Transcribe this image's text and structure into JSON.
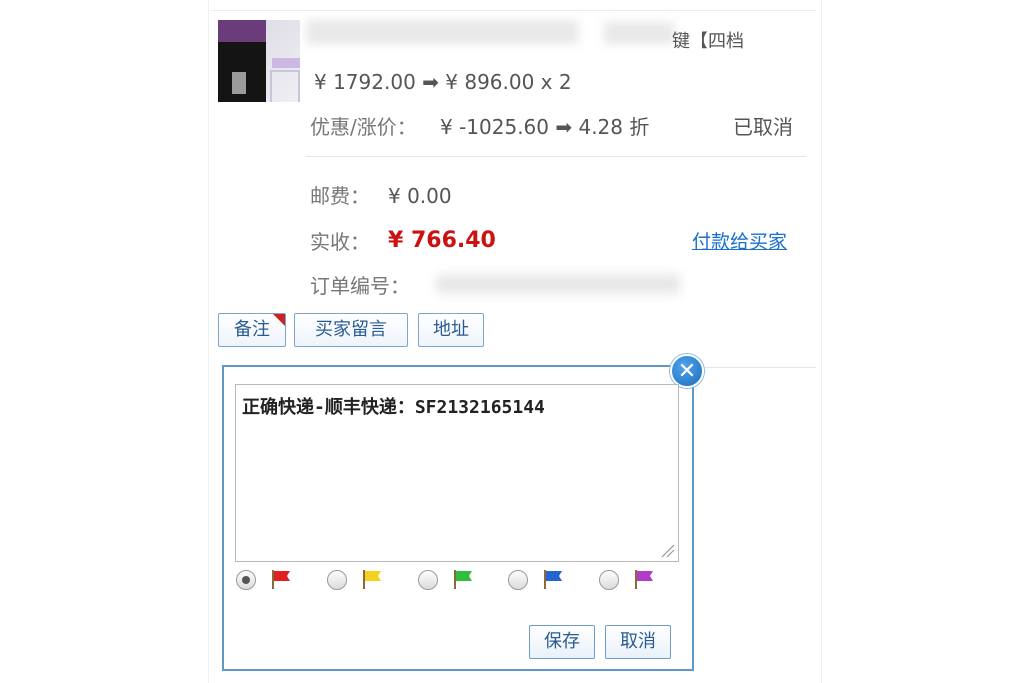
{
  "product": {
    "title_tail": "键【四档",
    "price_line": "¥ 1792.00 ➡ ¥ 896.00 x 2",
    "discount_label": "优惠/涨价：",
    "discount_value": "¥ -1025.60 ➡ 4.28 折",
    "status": "已取消"
  },
  "order": {
    "shipping_label": "邮费：",
    "shipping_value": "¥ 0.00",
    "received_label": "实收：",
    "received_value": "¥ 766.40",
    "pay_link": "付款给买家",
    "order_no_label": "订单编号："
  },
  "tabs": [
    {
      "label": "备注"
    },
    {
      "label": "买家留言"
    },
    {
      "label": "地址"
    }
  ],
  "note": {
    "text": "正确快递-顺丰快递：SF2132165144",
    "close_symbol": "✕"
  },
  "flags": [
    {
      "color": "#e02020",
      "selected": true
    },
    {
      "color": "#f2d21a",
      "selected": false
    },
    {
      "color": "#2fbf3a",
      "selected": false
    },
    {
      "color": "#2366d1",
      "selected": false
    },
    {
      "color": "#b03cc8",
      "selected": false
    }
  ],
  "buttons": {
    "save": "保存",
    "cancel": "取消"
  }
}
